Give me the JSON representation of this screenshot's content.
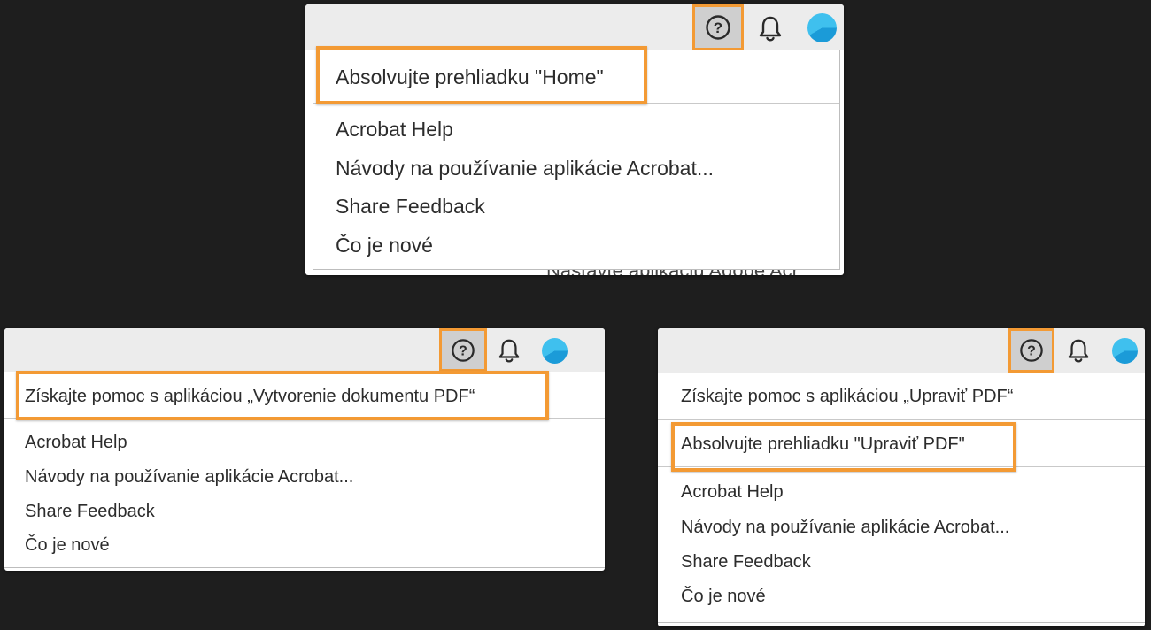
{
  "panels": {
    "home": {
      "items": {
        "tour": "Absolvujte prehliadku \"Home\"",
        "help": "Acrobat Help",
        "tutorials": "Návody na používanie aplikácie Acrobat...",
        "feedback": "Share Feedback",
        "whats_new": "Čo je nové"
      },
      "background_text": "Nastavte aplikáciu Adobe Acr"
    },
    "create_pdf": {
      "items": {
        "get_help": "Získajte pomoc s aplikáciou „Vytvorenie dokumentu PDF“",
        "help": "Acrobat Help",
        "tutorials": "Návody na používanie aplikácie Acrobat...",
        "feedback": "Share Feedback",
        "whats_new": "Čo je nové"
      }
    },
    "edit_pdf": {
      "items": {
        "get_help": "Získajte pomoc s aplikáciou „Upraviť PDF“",
        "tour": "Absolvujte prehliadku \"Upraviť PDF\"",
        "help": "Acrobat Help",
        "tutorials": "Návody na používanie aplikácie Acrobat...",
        "feedback": "Share Feedback",
        "whats_new": "Čo je nové"
      }
    }
  },
  "icons": {
    "help": "question-circle-icon",
    "notifications": "bell-icon",
    "profile": "avatar-icon"
  },
  "colors": {
    "highlight": "#f39a34",
    "toolbar": "#ececec",
    "backdrop": "#1e1e1e",
    "avatar": "#1b9bd8"
  }
}
